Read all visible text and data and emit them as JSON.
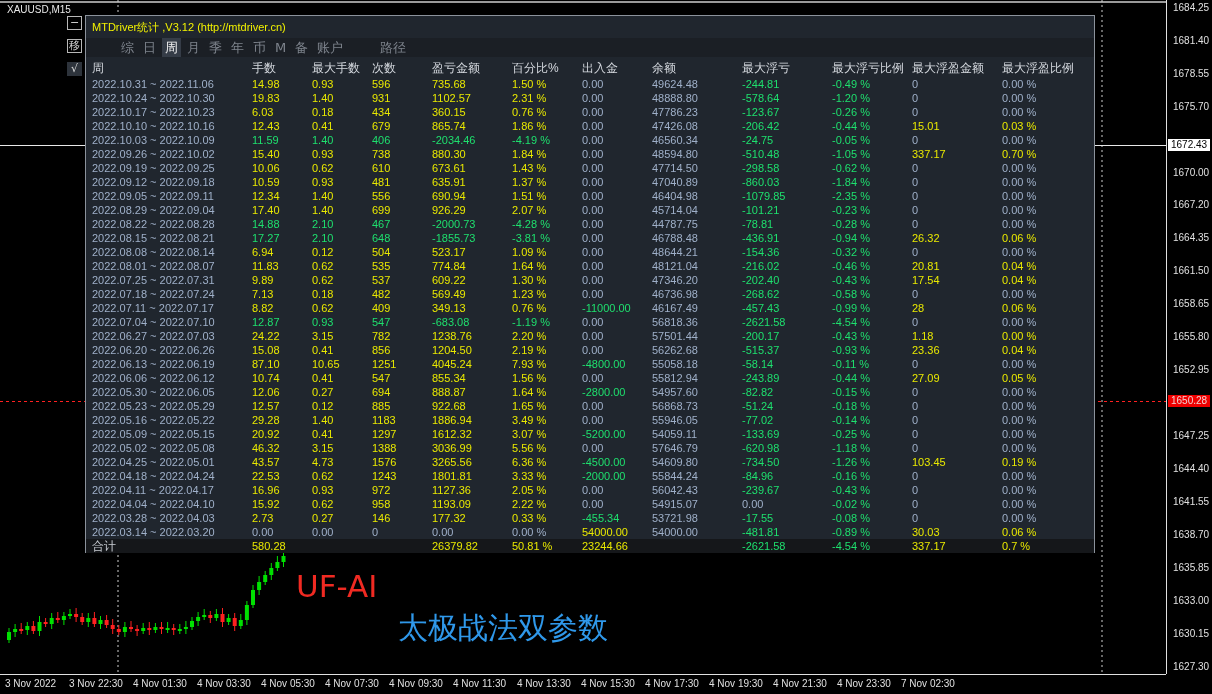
{
  "chart": {
    "symbol": "XAUUSD,M15",
    "side_buttons": [
      {
        "label": "−",
        "kind": "outline"
      },
      {
        "label": "移",
        "kind": "outline"
      },
      {
        "label": "√",
        "kind": "filled"
      }
    ],
    "overlay_texts": [
      {
        "text": "UF-AI",
        "kind": "brand"
      },
      {
        "text": "太极战法双参数",
        "kind": "subtitle"
      }
    ]
  },
  "panel": {
    "title": "MTDriver统计 ,V3.12 (http://mtdriver.cn)",
    "tabs": [
      {
        "label": "综",
        "selected": false
      },
      {
        "label": "日",
        "selected": false
      },
      {
        "label": "周",
        "selected": true
      },
      {
        "label": "月",
        "selected": false
      },
      {
        "label": "季",
        "selected": false
      },
      {
        "label": "年",
        "selected": false
      },
      {
        "label": "币",
        "selected": false
      },
      {
        "label": "M",
        "selected": false
      },
      {
        "label": "备",
        "selected": false
      },
      {
        "label": "账户",
        "selected": false
      }
    ],
    "extra_tab": {
      "label": "路径",
      "selected": false
    },
    "table": {
      "columns": [
        "周",
        "手数",
        "最大手数",
        "次数",
        "盈亏金额",
        "百分比%",
        "出入金",
        "余额",
        "最大浮亏",
        "最大浮亏比例",
        "最大浮盈金额",
        "最大浮盈比例"
      ],
      "rows": [
        {
          "cells": [
            "2022.10.31 ~ 2022.11.06",
            "14.98",
            "0.93",
            "596",
            "735.68",
            "1.50 %",
            "0.00",
            "49624.48",
            "-244.81",
            "-0.49 %",
            "0",
            "0.00 %"
          ],
          "empty": false,
          "loss": false,
          "withdrawal": false,
          "deposit": false,
          "drawdown": true,
          "float_gain": false
        },
        {
          "cells": [
            "2022.10.24 ~ 2022.10.30",
            "19.83",
            "1.40",
            "931",
            "1102.57",
            "2.31 %",
            "0.00",
            "48888.80",
            "-578.64",
            "-1.20 %",
            "0",
            "0.00 %"
          ],
          "empty": false,
          "loss": false,
          "withdrawal": false,
          "deposit": false,
          "drawdown": true,
          "float_gain": false
        },
        {
          "cells": [
            "2022.10.17 ~ 2022.10.23",
            "6.03",
            "0.18",
            "434",
            "360.15",
            "0.76 %",
            "0.00",
            "47786.23",
            "-123.67",
            "-0.26 %",
            "0",
            "0.00 %"
          ],
          "empty": false,
          "loss": false,
          "withdrawal": false,
          "deposit": false,
          "drawdown": true,
          "float_gain": false
        },
        {
          "cells": [
            "2022.10.10 ~ 2022.10.16",
            "12.43",
            "0.41",
            "679",
            "865.74",
            "1.86 %",
            "0.00",
            "47426.08",
            "-206.42",
            "-0.44 %",
            "15.01",
            "0.03 %"
          ],
          "empty": false,
          "loss": false,
          "withdrawal": false,
          "deposit": false,
          "drawdown": true,
          "float_gain": true
        },
        {
          "cells": [
            "2022.10.03 ~ 2022.10.09",
            "11.59",
            "1.40",
            "406",
            "-2034.46",
            "-4.19 %",
            "0.00",
            "46560.34",
            "-24.75",
            "-0.05 %",
            "0",
            "0.00 %"
          ],
          "empty": false,
          "loss": true,
          "withdrawal": false,
          "deposit": false,
          "drawdown": true,
          "float_gain": false
        },
        {
          "cells": [
            "2022.09.26 ~ 2022.10.02",
            "15.40",
            "0.93",
            "738",
            "880.30",
            "1.84 %",
            "0.00",
            "48594.80",
            "-510.48",
            "-1.05 %",
            "337.17",
            "0.70 %"
          ],
          "empty": false,
          "loss": false,
          "withdrawal": false,
          "deposit": false,
          "drawdown": true,
          "float_gain": true
        },
        {
          "cells": [
            "2022.09.19 ~ 2022.09.25",
            "10.06",
            "0.62",
            "610",
            "673.61",
            "1.43 %",
            "0.00",
            "47714.50",
            "-298.58",
            "-0.62 %",
            "0",
            "0.00 %"
          ],
          "empty": false,
          "loss": false,
          "withdrawal": false,
          "deposit": false,
          "drawdown": true,
          "float_gain": false
        },
        {
          "cells": [
            "2022.09.12 ~ 2022.09.18",
            "10.59",
            "0.93",
            "481",
            "635.91",
            "1.37 %",
            "0.00",
            "47040.89",
            "-860.03",
            "-1.84 %",
            "0",
            "0.00 %"
          ],
          "empty": false,
          "loss": false,
          "withdrawal": false,
          "deposit": false,
          "drawdown": true,
          "float_gain": false
        },
        {
          "cells": [
            "2022.09.05 ~ 2022.09.11",
            "12.34",
            "1.40",
            "556",
            "690.94",
            "1.51 %",
            "0.00",
            "46404.98",
            "-1079.85",
            "-2.35 %",
            "0",
            "0.00 %"
          ],
          "empty": false,
          "loss": false,
          "withdrawal": false,
          "deposit": false,
          "drawdown": true,
          "float_gain": false
        },
        {
          "cells": [
            "2022.08.29 ~ 2022.09.04",
            "17.40",
            "1.40",
            "699",
            "926.29",
            "2.07 %",
            "0.00",
            "45714.04",
            "-101.21",
            "-0.23 %",
            "0",
            "0.00 %"
          ],
          "empty": false,
          "loss": false,
          "withdrawal": false,
          "deposit": false,
          "drawdown": true,
          "float_gain": false
        },
        {
          "cells": [
            "2022.08.22 ~ 2022.08.28",
            "14.88",
            "2.10",
            "467",
            "-2000.73",
            "-4.28 %",
            "0.00",
            "44787.75",
            "-78.81",
            "-0.28 %",
            "0",
            "0.00 %"
          ],
          "empty": false,
          "loss": true,
          "withdrawal": false,
          "deposit": false,
          "drawdown": true,
          "float_gain": false
        },
        {
          "cells": [
            "2022.08.15 ~ 2022.08.21",
            "17.27",
            "2.10",
            "648",
            "-1855.73",
            "-3.81 %",
            "0.00",
            "46788.48",
            "-436.91",
            "-0.94 %",
            "26.32",
            "0.06 %"
          ],
          "empty": false,
          "loss": true,
          "withdrawal": false,
          "deposit": false,
          "drawdown": true,
          "float_gain": true
        },
        {
          "cells": [
            "2022.08.08 ~ 2022.08.14",
            "6.94",
            "0.12",
            "504",
            "523.17",
            "1.09 %",
            "0.00",
            "48644.21",
            "-154.36",
            "-0.32 %",
            "0",
            "0.00 %"
          ],
          "empty": false,
          "loss": false,
          "withdrawal": false,
          "deposit": false,
          "drawdown": true,
          "float_gain": false
        },
        {
          "cells": [
            "2022.08.01 ~ 2022.08.07",
            "11.83",
            "0.62",
            "535",
            "774.84",
            "1.64 %",
            "0.00",
            "48121.04",
            "-216.02",
            "-0.46 %",
            "20.81",
            "0.04 %"
          ],
          "empty": false,
          "loss": false,
          "withdrawal": false,
          "deposit": false,
          "drawdown": true,
          "float_gain": true
        },
        {
          "cells": [
            "2022.07.25 ~ 2022.07.31",
            "9.89",
            "0.62",
            "537",
            "609.22",
            "1.30 %",
            "0.00",
            "47346.20",
            "-202.40",
            "-0.43 %",
            "17.54",
            "0.04 %"
          ],
          "empty": false,
          "loss": false,
          "withdrawal": false,
          "deposit": false,
          "drawdown": true,
          "float_gain": true
        },
        {
          "cells": [
            "2022.07.18 ~ 2022.07.24",
            "7.13",
            "0.18",
            "482",
            "569.49",
            "1.23 %",
            "0.00",
            "46736.98",
            "-268.62",
            "-0.58 %",
            "0",
            "0.00 %"
          ],
          "empty": false,
          "loss": false,
          "withdrawal": false,
          "deposit": false,
          "drawdown": true,
          "float_gain": false
        },
        {
          "cells": [
            "2022.07.11 ~ 2022.07.17",
            "8.82",
            "0.62",
            "409",
            "349.13",
            "0.76 %",
            "-11000.00",
            "46167.49",
            "-457.43",
            "-0.99 %",
            "28",
            "0.06 %"
          ],
          "empty": false,
          "loss": false,
          "withdrawal": true,
          "deposit": false,
          "drawdown": true,
          "float_gain": true
        },
        {
          "cells": [
            "2022.07.04 ~ 2022.07.10",
            "12.87",
            "0.93",
            "547",
            "-683.08",
            "-1.19 %",
            "0.00",
            "56818.36",
            "-2621.58",
            "-4.54 %",
            "0",
            "0.00 %"
          ],
          "empty": false,
          "loss": true,
          "withdrawal": false,
          "deposit": false,
          "drawdown": true,
          "float_gain": false
        },
        {
          "cells": [
            "2022.06.27 ~ 2022.07.03",
            "24.22",
            "3.15",
            "782",
            "1238.76",
            "2.20 %",
            "0.00",
            "57501.44",
            "-200.17",
            "-0.43 %",
            "1.18",
            "0.00 %"
          ],
          "empty": false,
          "loss": false,
          "withdrawal": false,
          "deposit": false,
          "drawdown": true,
          "float_gain": true
        },
        {
          "cells": [
            "2022.06.20 ~ 2022.06.26",
            "15.08",
            "0.41",
            "856",
            "1204.50",
            "2.19 %",
            "0.00",
            "56262.68",
            "-515.37",
            "-0.93 %",
            "23.36",
            "0.04 %"
          ],
          "empty": false,
          "loss": false,
          "withdrawal": false,
          "deposit": false,
          "drawdown": true,
          "float_gain": true
        },
        {
          "cells": [
            "2022.06.13 ~ 2022.06.19",
            "87.10",
            "10.65",
            "1251",
            "4045.24",
            "7.93 %",
            "-4800.00",
            "55058.18",
            "-58.14",
            "-0.11 %",
            "0",
            "0.00 %"
          ],
          "empty": false,
          "loss": false,
          "withdrawal": true,
          "deposit": false,
          "drawdown": true,
          "float_gain": false
        },
        {
          "cells": [
            "2022.06.06 ~ 2022.06.12",
            "10.74",
            "0.41",
            "547",
            "855.34",
            "1.56 %",
            "0.00",
            "55812.94",
            "-243.89",
            "-0.44 %",
            "27.09",
            "0.05 %"
          ],
          "empty": false,
          "loss": false,
          "withdrawal": false,
          "deposit": false,
          "drawdown": true,
          "float_gain": true
        },
        {
          "cells": [
            "2022.05.30 ~ 2022.06.05",
            "12.06",
            "0.27",
            "694",
            "888.87",
            "1.64 %",
            "-2800.00",
            "54957.60",
            "-82.82",
            "-0.15 %",
            "0",
            "0.00 %"
          ],
          "empty": false,
          "loss": false,
          "withdrawal": true,
          "deposit": false,
          "drawdown": true,
          "float_gain": false
        },
        {
          "cells": [
            "2022.05.23 ~ 2022.05.29",
            "12.57",
            "0.12",
            "885",
            "922.68",
            "1.65 %",
            "0.00",
            "56868.73",
            "-51.24",
            "-0.18 %",
            "0",
            "0.00 %"
          ],
          "empty": false,
          "loss": false,
          "withdrawal": false,
          "deposit": false,
          "drawdown": true,
          "float_gain": false
        },
        {
          "cells": [
            "2022.05.16 ~ 2022.05.22",
            "29.28",
            "1.40",
            "1183",
            "1886.94",
            "3.49 %",
            "0.00",
            "55946.05",
            "-77.02",
            "-0.14 %",
            "0",
            "0.00 %"
          ],
          "empty": false,
          "loss": false,
          "withdrawal": false,
          "deposit": false,
          "drawdown": true,
          "float_gain": false
        },
        {
          "cells": [
            "2022.05.09 ~ 2022.05.15",
            "20.92",
            "0.41",
            "1297",
            "1612.32",
            "3.07 %",
            "-5200.00",
            "54059.11",
            "-133.69",
            "-0.25 %",
            "0",
            "0.00 %"
          ],
          "empty": false,
          "loss": false,
          "withdrawal": true,
          "deposit": false,
          "drawdown": true,
          "float_gain": false
        },
        {
          "cells": [
            "2022.05.02 ~ 2022.05.08",
            "46.32",
            "3.15",
            "1388",
            "3036.99",
            "5.56 %",
            "0.00",
            "57646.79",
            "-620.98",
            "-1.18 %",
            "0",
            "0.00 %"
          ],
          "empty": false,
          "loss": false,
          "withdrawal": false,
          "deposit": false,
          "drawdown": true,
          "float_gain": false
        },
        {
          "cells": [
            "2022.04.25 ~ 2022.05.01",
            "43.57",
            "4.73",
            "1576",
            "3265.56",
            "6.36 %",
            "-4500.00",
            "54609.80",
            "-734.50",
            "-1.26 %",
            "103.45",
            "0.19 %"
          ],
          "empty": false,
          "loss": false,
          "withdrawal": true,
          "deposit": false,
          "drawdown": true,
          "float_gain": true
        },
        {
          "cells": [
            "2022.04.18 ~ 2022.04.24",
            "22.53",
            "0.62",
            "1243",
            "1801.81",
            "3.33 %",
            "-2000.00",
            "55844.24",
            "-84.96",
            "-0.16 %",
            "0",
            "0.00 %"
          ],
          "empty": false,
          "loss": false,
          "withdrawal": true,
          "deposit": false,
          "drawdown": true,
          "float_gain": false
        },
        {
          "cells": [
            "2022.04.11 ~ 2022.04.17",
            "16.96",
            "0.93",
            "972",
            "1127.36",
            "2.05 %",
            "0.00",
            "56042.43",
            "-239.67",
            "-0.43 %",
            "0",
            "0.00 %"
          ],
          "empty": false,
          "loss": false,
          "withdrawal": false,
          "deposit": false,
          "drawdown": true,
          "float_gain": false
        },
        {
          "cells": [
            "2022.04.04 ~ 2022.04.10",
            "15.92",
            "0.62",
            "958",
            "1193.09",
            "2.22 %",
            "0.00",
            "54915.07",
            "0.00",
            "-0.02 %",
            "0",
            "0.00 %"
          ],
          "empty": false,
          "loss": false,
          "withdrawal": false,
          "deposit": false,
          "drawdown": false,
          "float_gain": false
        },
        {
          "cells": [
            "2022.03.28 ~ 2022.04.03",
            "2.73",
            "0.27",
            "146",
            "177.32",
            "0.33 %",
            "-455.34",
            "53721.98",
            "-17.55",
            "-0.08 %",
            "0",
            "0.00 %"
          ],
          "empty": false,
          "loss": false,
          "withdrawal": true,
          "deposit": false,
          "drawdown": true,
          "float_gain": false
        },
        {
          "cells": [
            "2022.03.14 ~ 2022.03.20",
            "0.00",
            "0.00",
            "0",
            "0.00",
            "0.00 %",
            "54000.00",
            "54000.00",
            "-481.81",
            "-0.89 %",
            "30.03",
            "0.06 %"
          ],
          "empty": true,
          "loss": false,
          "withdrawal": false,
          "deposit": true,
          "drawdown": true,
          "float_gain": true
        }
      ],
      "total": {
        "label": "合计",
        "lots": "580.28",
        "pnl": "26379.82",
        "pct": "50.81 %",
        "flow": "23244.66",
        "max_dd": "-2621.58",
        "max_dd_pct": "-4.54 %",
        "max_fp": "337.17",
        "max_fp_pct": "0.7 %"
      }
    }
  },
  "price_axis": {
    "ticks": [
      "1684.25",
      "1681.40",
      "1678.55",
      "1675.70",
      "1670.00",
      "1667.20",
      "1664.35",
      "1661.50",
      "1658.65",
      "1655.80",
      "1652.95",
      "1647.25",
      "1644.40",
      "1641.55",
      "1638.70",
      "1635.85",
      "1633.00",
      "1630.15",
      "1627.30"
    ],
    "markers": [
      {
        "price": "1672.43",
        "kind": "crosshair"
      },
      {
        "price": "1650.28",
        "kind": "bid"
      }
    ]
  },
  "time_axis": {
    "labels": [
      "3 Nov 2022",
      "3 Nov 22:30",
      "4 Nov 01:30",
      "4 Nov 03:30",
      "4 Nov 05:30",
      "4 Nov 07:30",
      "4 Nov 09:30",
      "4 Nov 11:30",
      "4 Nov 13:30",
      "4 Nov 15:30",
      "4 Nov 17:30",
      "4 Nov 19:30",
      "4 Nov 21:30",
      "4 Nov 23:30",
      "7 Nov 02:30"
    ]
  }
}
